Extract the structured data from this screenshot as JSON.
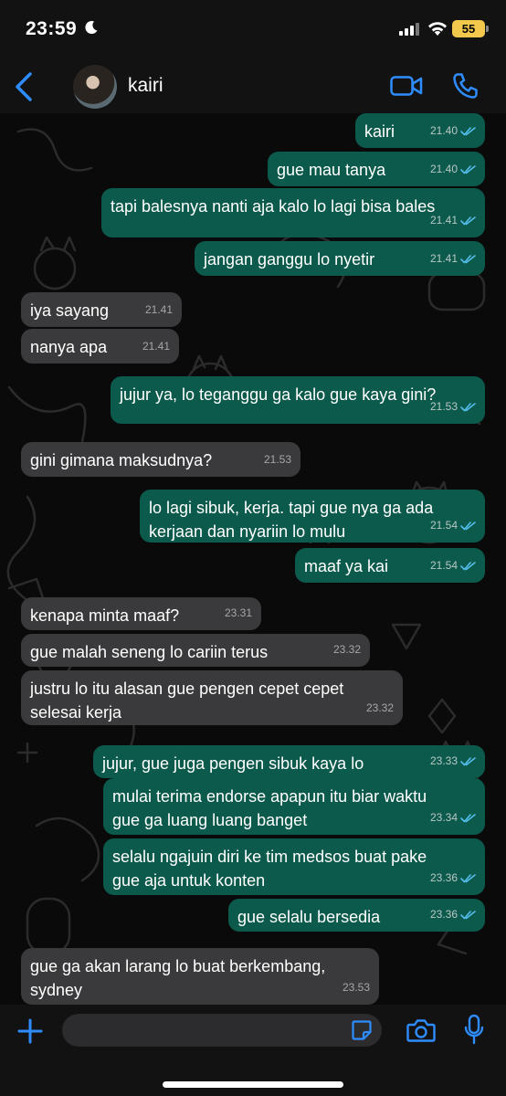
{
  "status_bar": {
    "time": "23:59",
    "battery": "55"
  },
  "header": {
    "contact_name": "kairi"
  },
  "messages": [
    {
      "dir": "out",
      "text": [
        "kairi"
      ],
      "time": "21.40"
    },
    {
      "dir": "out",
      "text": [
        "gue mau tanya"
      ],
      "time": "21.40"
    },
    {
      "dir": "out",
      "text": [
        "tapi balesnya nanti aja kalo lo lagi bisa bales"
      ],
      "time": "21.41"
    },
    {
      "dir": "out",
      "text": [
        "jangan ganggu lo nyetir"
      ],
      "time": "21.41"
    },
    {
      "dir": "in",
      "text": [
        "iya sayang"
      ],
      "time": "21.41"
    },
    {
      "dir": "in",
      "text": [
        "nanya apa"
      ],
      "time": "21.41"
    },
    {
      "dir": "out",
      "text": [
        "jujur ya, lo teganggu ga kalo gue kaya gini?"
      ],
      "time": "21.53"
    },
    {
      "dir": "in",
      "text": [
        "gini gimana maksudnya?"
      ],
      "time": "21.53"
    },
    {
      "dir": "out",
      "text": [
        "lo lagi sibuk, kerja. tapi gue nya ga ada",
        "kerjaan dan nyariin lo mulu"
      ],
      "time": "21.54"
    },
    {
      "dir": "out",
      "text": [
        "maaf ya kai"
      ],
      "time": "21.54"
    },
    {
      "dir": "in",
      "text": [
        "kenapa minta maaf?"
      ],
      "time": "23.31"
    },
    {
      "dir": "in",
      "text": [
        "gue malah seneng lo cariin terus"
      ],
      "time": "23.32"
    },
    {
      "dir": "in",
      "text": [
        "justru lo itu alasan gue pengen cepet cepet",
        "selesai kerja"
      ],
      "time": "23.32"
    },
    {
      "dir": "out",
      "text": [
        "jujur, gue juga pengen sibuk kaya lo"
      ],
      "time": "23.33"
    },
    {
      "dir": "out",
      "text": [
        "mulai terima endorse apapun itu biar waktu",
        "gue ga luang luang banget"
      ],
      "time": "23.34"
    },
    {
      "dir": "out",
      "text": [
        "selalu ngajuin diri ke tim medsos buat pake",
        "gue aja untuk konten"
      ],
      "time": "23.36"
    },
    {
      "dir": "out",
      "text": [
        "gue selalu bersedia"
      ],
      "time": "23.36"
    },
    {
      "dir": "in",
      "text": [
        "gue ga akan larang lo buat berkembang,",
        "sydney"
      ],
      "time": "23.53"
    }
  ],
  "colors": {
    "outgoing_bubble": "#0c5a4c",
    "incoming_bubble": "#3a3a3c",
    "accent": "#2f8cff",
    "read_ticks": "#53bdeb",
    "battery": "#f2c94c"
  }
}
